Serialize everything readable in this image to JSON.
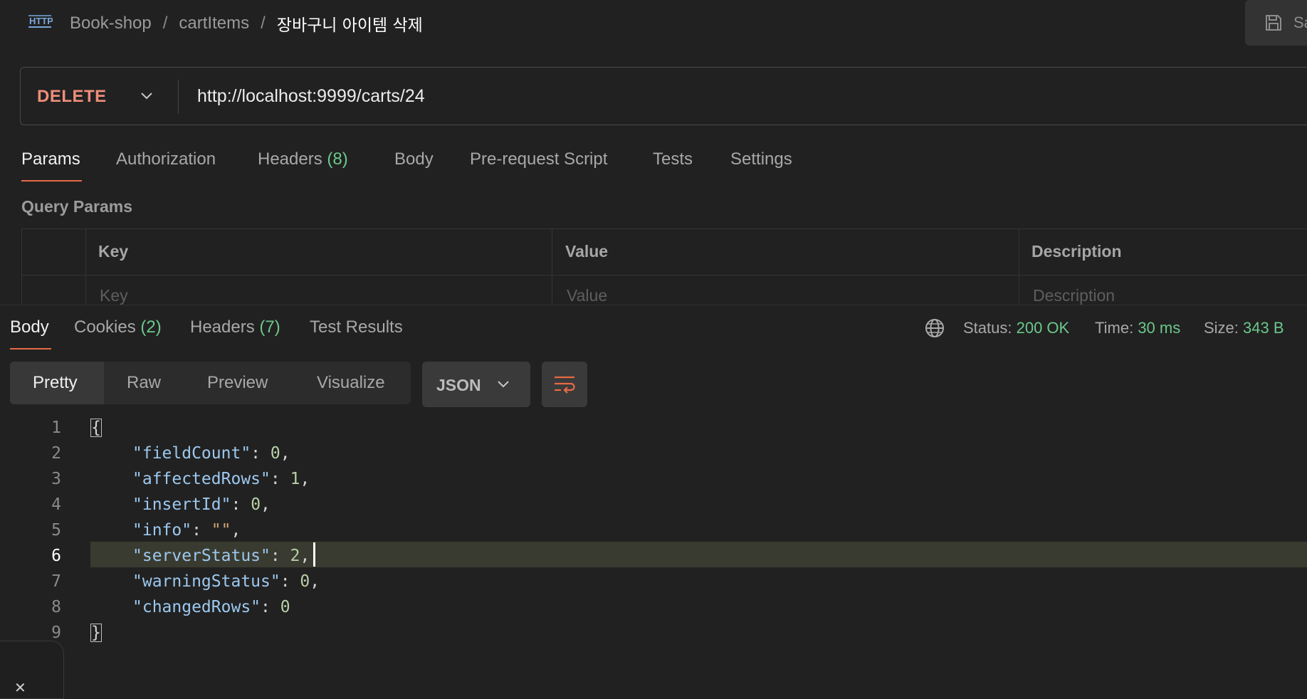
{
  "breadcrumb": {
    "items": [
      "Book-shop",
      "cartItems"
    ],
    "current": "장바구니 아이템 삭제",
    "separator": "/"
  },
  "toolbar": {
    "save_label": "Sa"
  },
  "request": {
    "method": "DELETE",
    "url": "http://localhost:9999/carts/24",
    "tabs": [
      {
        "label": "Params",
        "count": ""
      },
      {
        "label": "Authorization",
        "count": ""
      },
      {
        "label": "Headers",
        "count": "(8)"
      },
      {
        "label": "Body",
        "count": ""
      },
      {
        "label": "Pre-request Script",
        "count": ""
      },
      {
        "label": "Tests",
        "count": ""
      },
      {
        "label": "Settings",
        "count": ""
      }
    ],
    "active_tab": "Params"
  },
  "query_params": {
    "title": "Query Params",
    "headers": [
      "Key",
      "Value",
      "Description"
    ],
    "placeholders": [
      "Key",
      "Value",
      "Description"
    ]
  },
  "response": {
    "tabs": [
      {
        "label": "Body",
        "count": ""
      },
      {
        "label": "Cookies",
        "count": "(2)"
      },
      {
        "label": "Headers",
        "count": "(7)"
      },
      {
        "label": "Test Results",
        "count": ""
      }
    ],
    "active_tab": "Body",
    "status": {
      "label": "Status:",
      "value": "200 OK"
    },
    "time": {
      "label": "Time:",
      "value": "30 ms"
    },
    "size": {
      "label": "Size:",
      "value": "343 B"
    },
    "views": [
      "Pretty",
      "Raw",
      "Preview",
      "Visualize"
    ],
    "active_view": "Pretty",
    "format": "JSON",
    "body_lines": [
      {
        "n": "1",
        "brace": "{"
      },
      {
        "n": "2",
        "key": "\"fieldCount\"",
        "sep": ": ",
        "val": "0",
        "type": "n",
        "end": ","
      },
      {
        "n": "3",
        "key": "\"affectedRows\"",
        "sep": ": ",
        "val": "1",
        "type": "n",
        "end": ","
      },
      {
        "n": "4",
        "key": "\"insertId\"",
        "sep": ": ",
        "val": "0",
        "type": "n",
        "end": ","
      },
      {
        "n": "5",
        "key": "\"info\"",
        "sep": ": ",
        "val": "\"\"",
        "type": "s",
        "end": ","
      },
      {
        "n": "6",
        "key": "\"serverStatus\"",
        "sep": ": ",
        "val": "2",
        "type": "n",
        "end": ","
      },
      {
        "n": "7",
        "key": "\"warningStatus\"",
        "sep": ": ",
        "val": "0",
        "type": "n",
        "end": ","
      },
      {
        "n": "8",
        "key": "\"changedRows\"",
        "sep": ": ",
        "val": "0",
        "type": "n",
        "end": ""
      },
      {
        "n": "9",
        "brace": "}"
      }
    ],
    "current_line": "6"
  },
  "colors": {
    "accent": "#e86a45",
    "method": "#ee8d7b",
    "success": "#6bc88c",
    "json_key": "#9cc8ef",
    "json_number": "#b8cfa6",
    "json_string": "#d0a776"
  },
  "icons": [
    "http-icon",
    "save-icon",
    "chevron-down-icon",
    "globe-icon",
    "wrap-lines-icon",
    "close-icon"
  ]
}
